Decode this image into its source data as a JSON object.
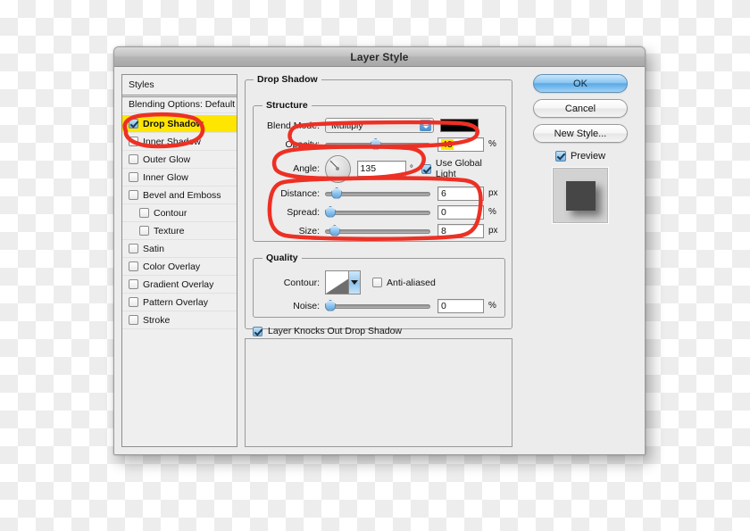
{
  "window": {
    "title": "Layer Style"
  },
  "styles_panel": {
    "header": "Styles",
    "blending_options": "Blending Options: Default",
    "items": [
      {
        "label": "Drop Shadow",
        "checked": true,
        "indent": false,
        "selected": true
      },
      {
        "label": "Inner Shadow",
        "checked": false,
        "indent": false,
        "selected": false
      },
      {
        "label": "Outer Glow",
        "checked": false,
        "indent": false,
        "selected": false
      },
      {
        "label": "Inner Glow",
        "checked": false,
        "indent": false,
        "selected": false
      },
      {
        "label": "Bevel and Emboss",
        "checked": false,
        "indent": false,
        "selected": false
      },
      {
        "label": "Contour",
        "checked": false,
        "indent": true,
        "selected": false
      },
      {
        "label": "Texture",
        "checked": false,
        "indent": true,
        "selected": false
      },
      {
        "label": "Satin",
        "checked": false,
        "indent": false,
        "selected": false
      },
      {
        "label": "Color Overlay",
        "checked": false,
        "indent": false,
        "selected": false
      },
      {
        "label": "Gradient Overlay",
        "checked": false,
        "indent": false,
        "selected": false
      },
      {
        "label": "Pattern Overlay",
        "checked": false,
        "indent": false,
        "selected": false
      },
      {
        "label": "Stroke",
        "checked": false,
        "indent": false,
        "selected": false
      }
    ]
  },
  "drop_shadow": {
    "group_title": "Drop Shadow",
    "structure": {
      "group_title": "Structure",
      "blend_mode_label": "Blend Mode:",
      "blend_mode_value": "Multiply",
      "shadow_color": "#000000",
      "opacity_label": "Opacity:",
      "opacity_value": "43",
      "opacity_unit": "%",
      "angle_label": "Angle:",
      "angle_value": "135",
      "angle_unit": "°",
      "use_global_light_label": "Use Global Light",
      "use_global_light_checked": true,
      "distance_label": "Distance:",
      "distance_value": "6",
      "distance_unit": "px",
      "spread_label": "Spread:",
      "spread_value": "0",
      "spread_unit": "%",
      "size_label": "Size:",
      "size_value": "8",
      "size_unit": "px"
    },
    "quality": {
      "group_title": "Quality",
      "contour_label": "Contour:",
      "anti_aliased_label": "Anti-aliased",
      "anti_aliased_checked": false,
      "noise_label": "Noise:",
      "noise_value": "0",
      "noise_unit": "%"
    },
    "knocks_out_label": "Layer Knocks Out Drop Shadow",
    "knocks_out_checked": true
  },
  "buttons": {
    "ok": "OK",
    "cancel": "Cancel",
    "new_style": "New Style...",
    "preview_label": "Preview",
    "preview_checked": true
  },
  "annotation": {
    "color": "#ed3024",
    "note": "hand-drawn red highlight circles"
  }
}
